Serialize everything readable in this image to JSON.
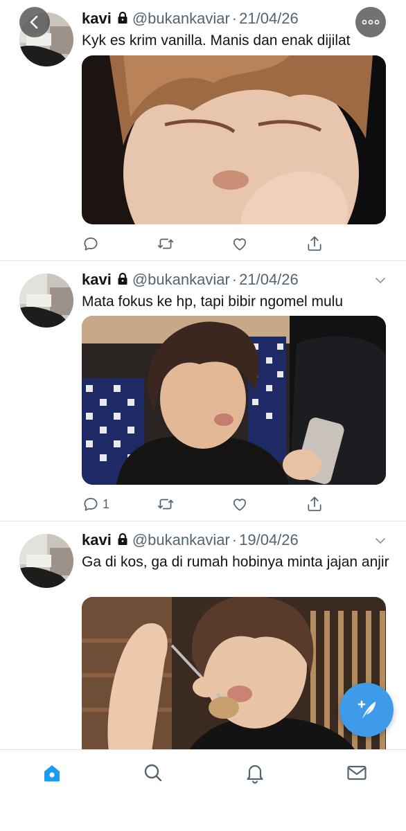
{
  "colors": {
    "accent": "#1d9bf0",
    "fab": "#3d9be9",
    "secondary_text": "#536471",
    "separator": "#e6e9eb"
  },
  "top_bar": {
    "back_icon": "chevron-left-icon",
    "more_icon": "more-horizontal-icon"
  },
  "tweets": [
    {
      "name": "kavi",
      "lock_icon": "lock-icon",
      "handle": "@bukankaviar",
      "separator": "·",
      "date": "21/04/26",
      "text": "Kyk es krim vanilla. Manis dan enak dijilat",
      "media_icon": "photo",
      "actions": {
        "reply": "",
        "retweet": "",
        "like": "",
        "share": ""
      }
    },
    {
      "name": "kavi",
      "lock_icon": "lock-icon",
      "handle": "@bukankaviar",
      "separator": "·",
      "date": "21/04/26",
      "text": "Mata fokus ke hp, tapi bibir ngomel mulu",
      "media_icon": "photo",
      "actions": {
        "reply": "1",
        "retweet": "",
        "like": "",
        "share": ""
      }
    },
    {
      "name": "kavi",
      "lock_icon": "lock-icon",
      "handle": "@bukankaviar",
      "separator": "·",
      "date": "19/04/26",
      "text": "Ga di kos, ga di rumah hobinya minta jajan anjir",
      "media_icon": "photo",
      "actions": {
        "reply": "",
        "retweet": "",
        "like": "",
        "share": ""
      }
    }
  ],
  "fab": {
    "icon": "compose-tweet-icon"
  },
  "tab_bar": {
    "items": [
      {
        "icon": "home-icon",
        "active": true
      },
      {
        "icon": "search-icon",
        "active": false
      },
      {
        "icon": "notifications-bell-icon",
        "active": false
      },
      {
        "icon": "messages-envelope-icon",
        "active": false
      }
    ]
  }
}
